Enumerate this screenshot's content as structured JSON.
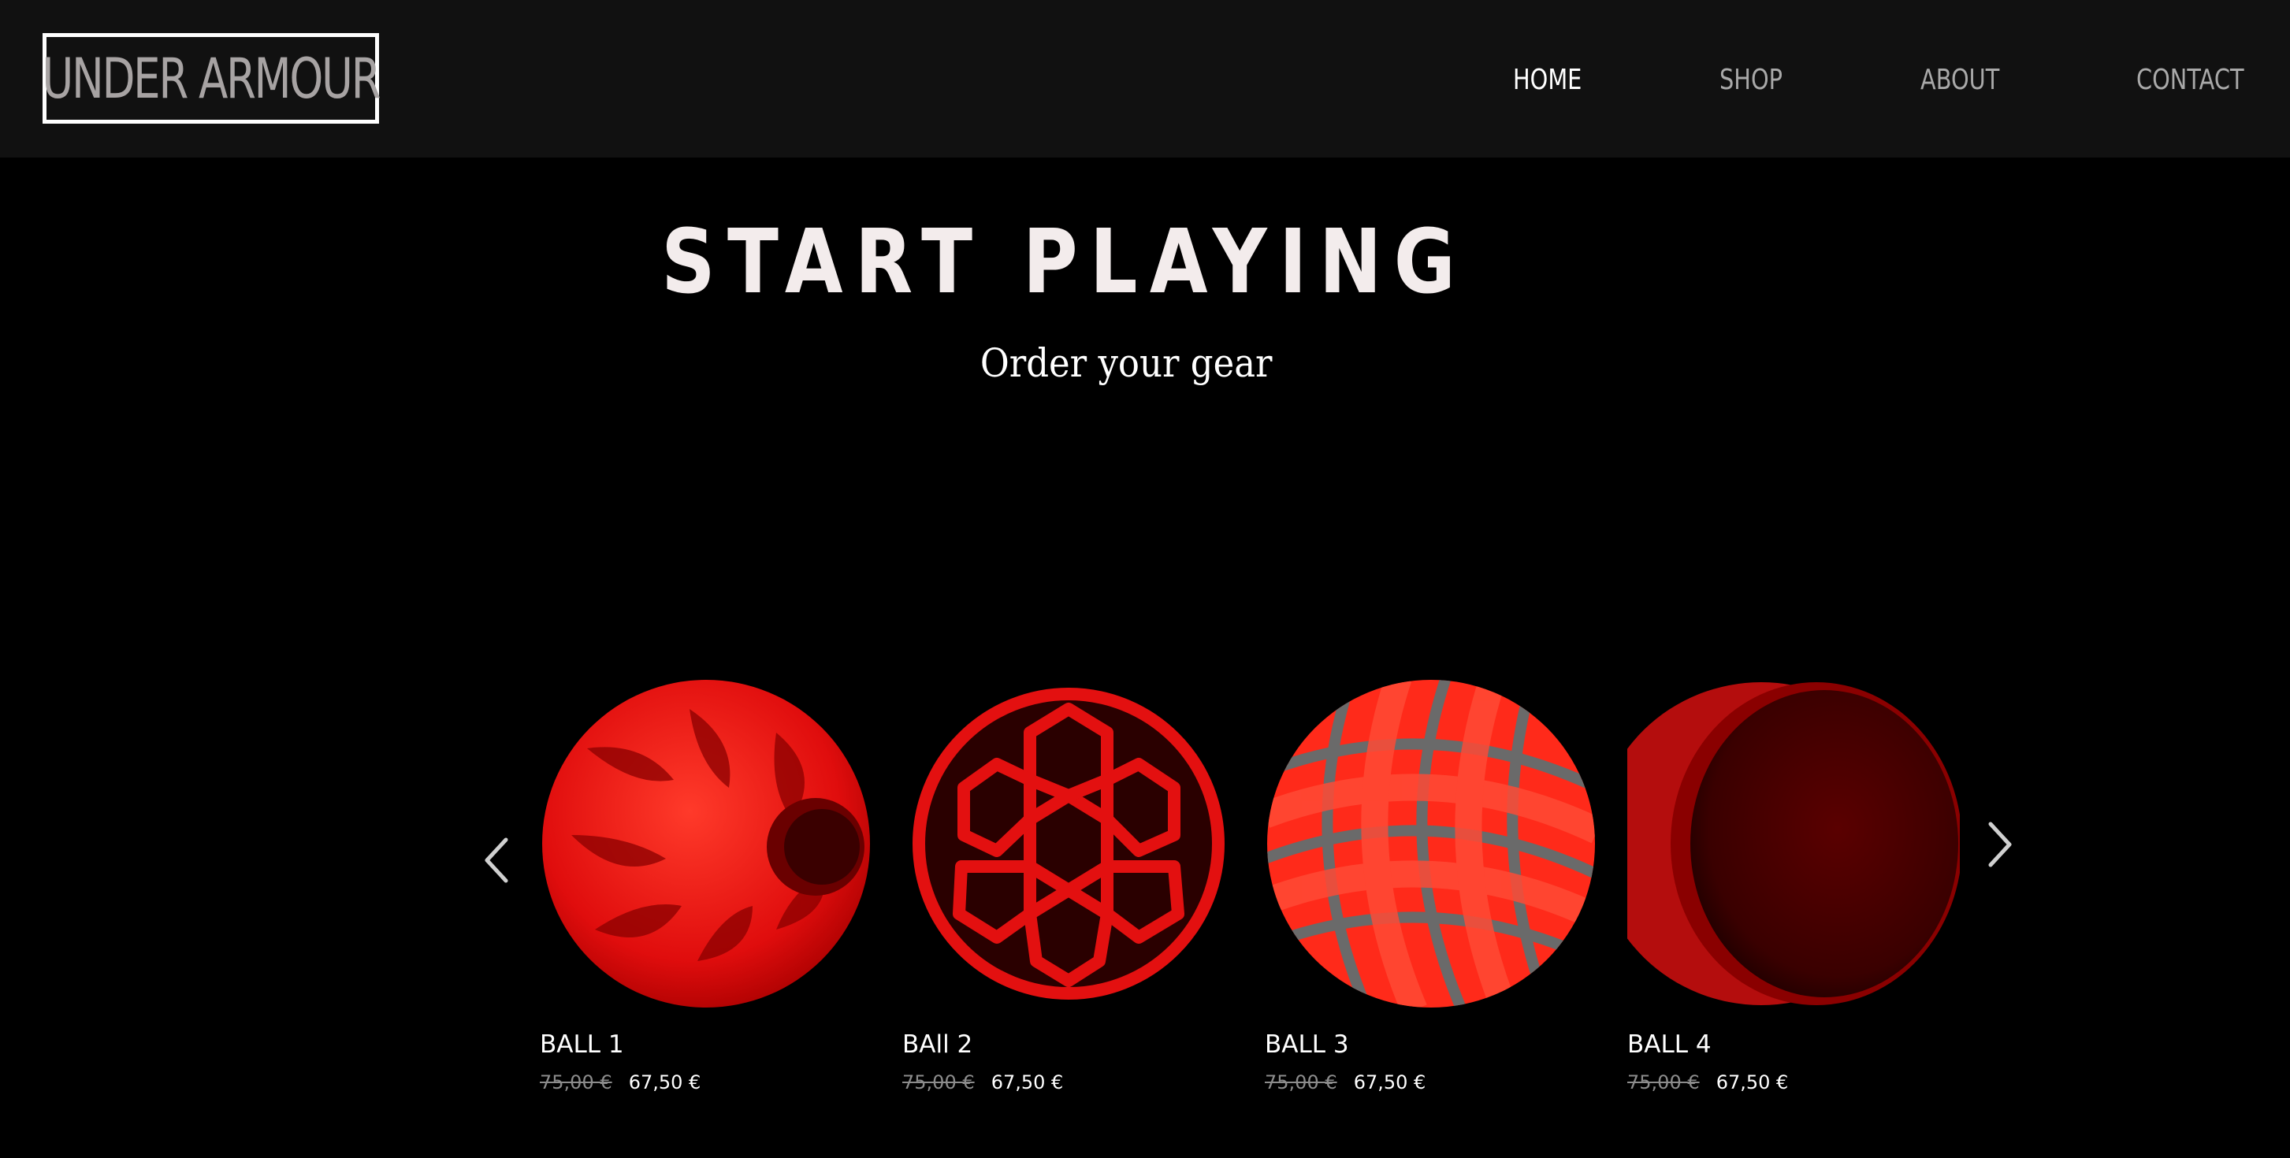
{
  "header": {
    "logo_text": "UNDER ARMOUR",
    "nav": [
      {
        "label": "HOME",
        "active": true
      },
      {
        "label": "SHOP",
        "active": false
      },
      {
        "label": "ABOUT",
        "active": false
      },
      {
        "label": "CONTACT",
        "active": false
      }
    ]
  },
  "hero": {
    "title": "START PLAYING",
    "subtitle": "Order your gear"
  },
  "carousel": {
    "prev_icon": "chevron-left-icon",
    "next_icon": "chevron-right-icon",
    "products": [
      {
        "name": "BALL 1",
        "old_price": "75,00 €",
        "price": "67,50 €",
        "image": "red-spiked-ball"
      },
      {
        "name": "BAll 2",
        "old_price": "75,00 €",
        "price": "67,50 €",
        "image": "red-lattice-ball"
      },
      {
        "name": "BALL 3",
        "old_price": "75,00 €",
        "price": "67,50 €",
        "image": "red-woven-ball"
      },
      {
        "name": "BALL 4",
        "old_price": "75,00 €",
        "price": "67,50 €",
        "image": "dark-red-disc"
      }
    ]
  },
  "colors": {
    "background": "#000000",
    "header_bg": "#111111",
    "nav_text": "#a9a9a9",
    "nav_active": "#ffffff",
    "product_red": "#e01010",
    "old_price": "#8c8c8c"
  }
}
